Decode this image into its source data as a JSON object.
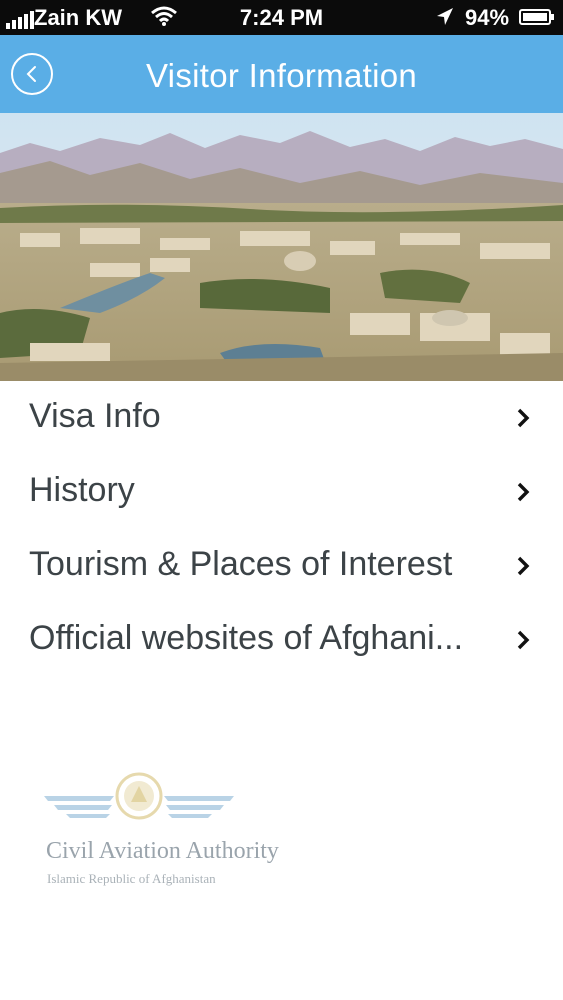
{
  "status_bar": {
    "carrier": "Zain KW",
    "time": "7:24 PM",
    "battery_percent": "94%",
    "battery_level": 0.94,
    "icons": [
      "signal-icon",
      "wifi-icon",
      "location-arrow-icon",
      "battery-icon"
    ]
  },
  "nav": {
    "title": "Visitor Information",
    "back_icon": "chevron-left-circle-icon",
    "bar_color": "#5aaee6"
  },
  "hero": {
    "description_icon": "city-panorama-image"
  },
  "menu": {
    "items": [
      {
        "label": "Visa Info"
      },
      {
        "label": "History"
      },
      {
        "label": "Tourism & Places of Interest"
      },
      {
        "label": "Official websites of Afghani..."
      }
    ],
    "chevron_icon": "chevron-right-icon"
  },
  "logo": {
    "org_name": "Civil Aviation Authority",
    "org_subtitle": "Islamic Republic of Afghanistan"
  }
}
